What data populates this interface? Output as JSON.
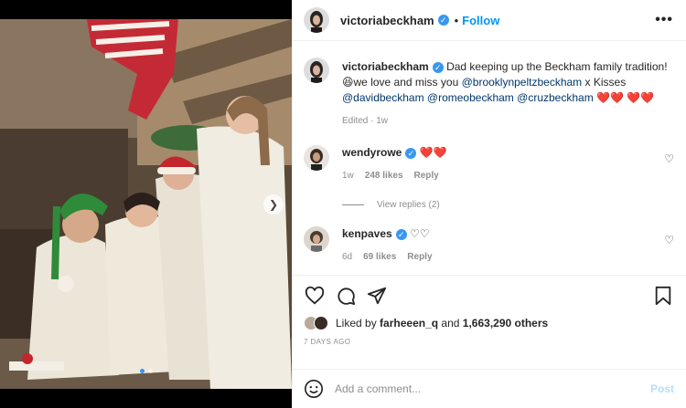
{
  "post": {
    "username": "victoriabeckham",
    "follow_label": "Follow",
    "separator": "•",
    "more_label": "•••"
  },
  "caption": {
    "username": "victoriabeckham",
    "text_1": "Dad keeping up the Beckham family tradition!",
    "emoji_1": "😆",
    "text_2": "we love and miss you",
    "mention_1": "@brooklynpeltzbeckham",
    "text_3": "x Kisses",
    "mention_2": "@davidbeckham",
    "mention_3": "@romeobeckham",
    "mention_4": "@cruzbeckham",
    "hearts": "❤️❤️",
    "hearts_2": "❤️❤️",
    "time": "Edited · 1w"
  },
  "comments": [
    {
      "username": "wendyrowe",
      "text": "❤️❤️",
      "time": "1w",
      "likes": "248 likes",
      "reply_label": "Reply",
      "view_replies": "View replies (2)"
    },
    {
      "username": "kenpaves",
      "text": "♡♡",
      "time": "6d",
      "likes": "69 likes",
      "reply_label": "Reply"
    }
  ],
  "engagement": {
    "liked_by_prefix": "Liked by",
    "liked_by_user": "farheeen_q",
    "liked_by_and": "and",
    "others": "1,663,290 others",
    "date": "7 DAYS AGO"
  },
  "add_comment": {
    "placeholder": "Add a comment...",
    "post_label": "Post"
  },
  "icons": [
    "heart-icon",
    "comment-icon",
    "share-icon",
    "bookmark-icon",
    "emoji-icon",
    "verified-icon",
    "more-icon",
    "chevron-right-icon"
  ],
  "colors": {
    "accent": "#0095f6",
    "verified": "#3897f0",
    "text": "#262626",
    "muted": "#8e8e8e",
    "heart": "#ed4956"
  }
}
